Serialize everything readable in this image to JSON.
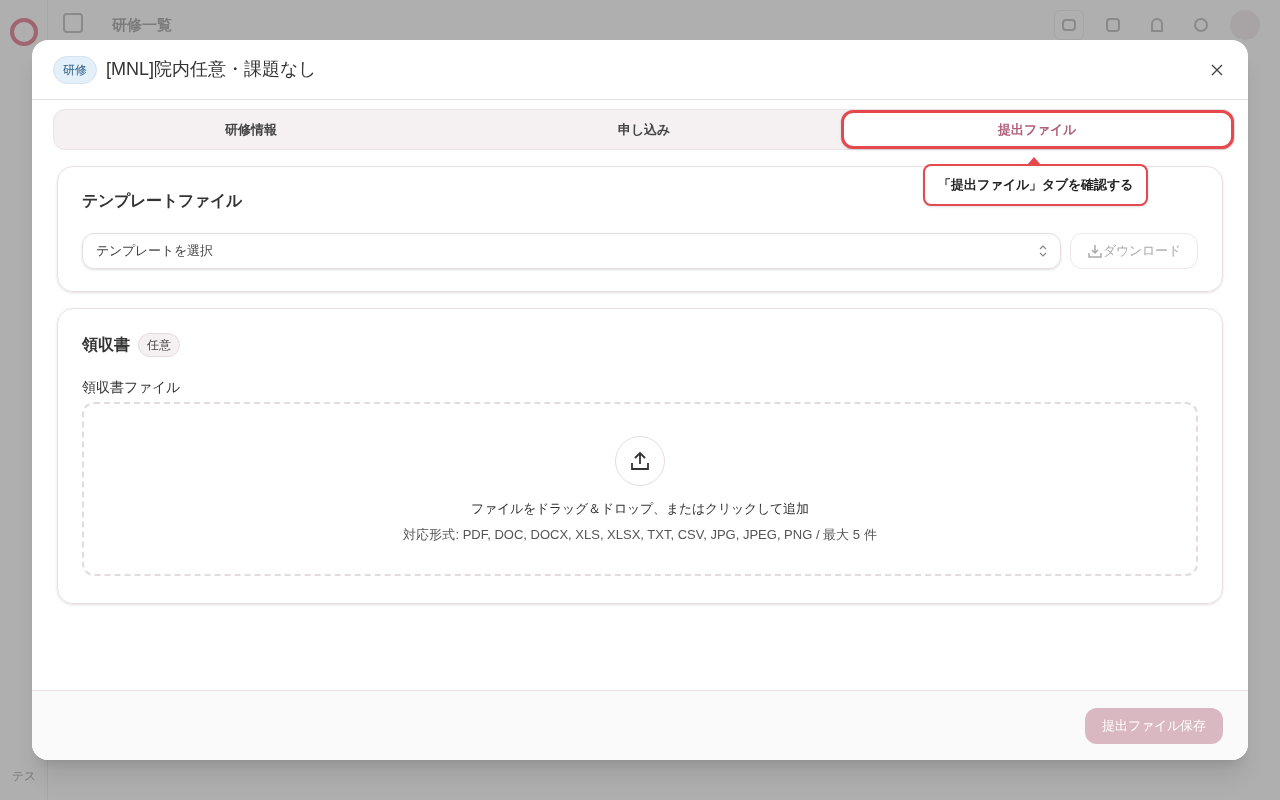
{
  "background": {
    "page_title": "研修一覧",
    "user_initials": "テス"
  },
  "dialog": {
    "badge": "研修",
    "title": "[MNL]院内任意・課題なし"
  },
  "tabs": [
    {
      "label": "研修情報",
      "selected": false,
      "highlighted": false
    },
    {
      "label": "申し込み",
      "selected": false,
      "highlighted": false
    },
    {
      "label": "提出ファイル",
      "selected": true,
      "highlighted": true
    }
  ],
  "callout": "「提出ファイル」タブを確認する",
  "template_section": {
    "title": "テンプレートファイル",
    "select_placeholder": "テンプレートを選択",
    "download_button": {
      "label": "ダウンロード",
      "disabled": true
    }
  },
  "receipt_section": {
    "title": "領収書",
    "tag": "任意",
    "field_label": "領収書ファイル",
    "dropzone_text": "ファイルをドラッグ＆ドロップ、またはクリックして追加",
    "dropzone_hint": "対応形式: PDF, DOC, DOCX, XLS, XLSX, TXT, CSV, JPG, JPEG, PNG / 最大 5 件"
  },
  "footer": {
    "save_button": {
      "label": "提出ファイル保存",
      "disabled": true
    }
  }
}
